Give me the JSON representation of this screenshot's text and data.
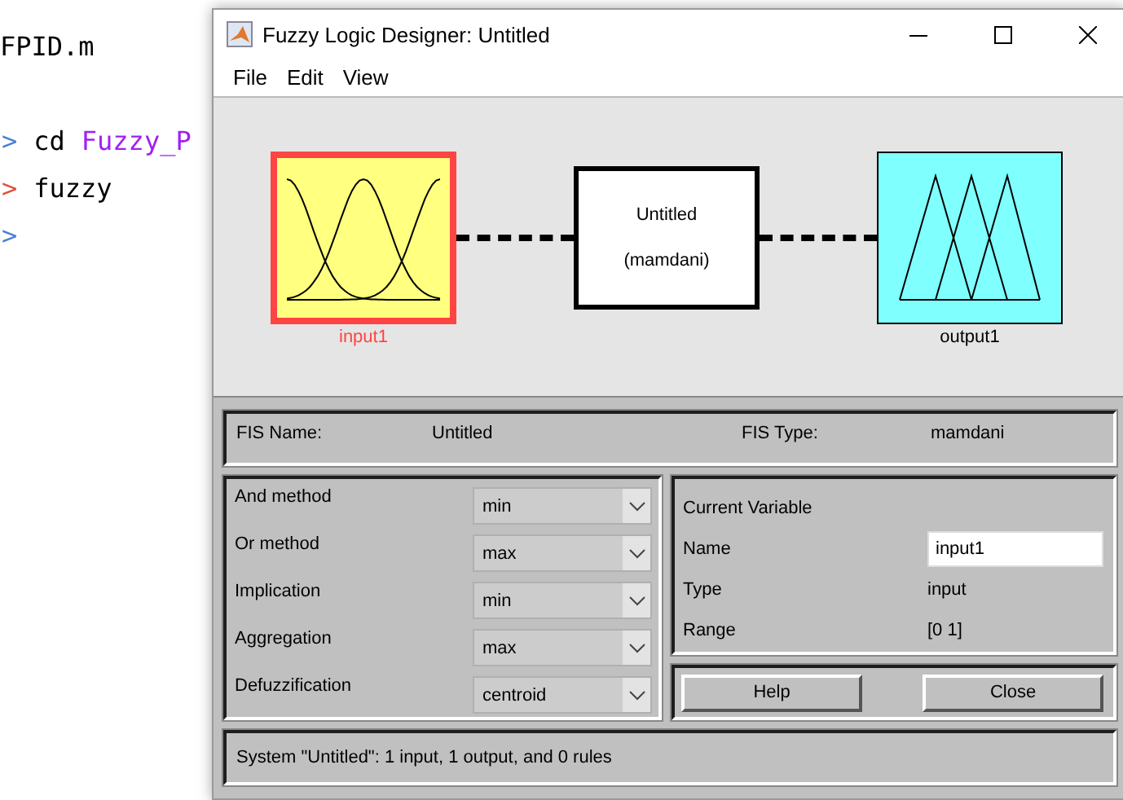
{
  "editor": {
    "file_line": "FPID.m",
    "lines": [
      {
        "prompt": ">",
        "color": "#4a7fd6",
        "parts": [
          {
            "text": "cd",
            "kind": "command"
          },
          {
            "text": "Fuzzy_P",
            "kind": "argument"
          }
        ]
      },
      {
        "prompt": ">",
        "color": "#e0513a",
        "parts": [
          {
            "text": "fuzzy",
            "kind": "command"
          }
        ]
      },
      {
        "prompt": ">",
        "color": "#4a7fd6"
      }
    ]
  },
  "window": {
    "title": "Fuzzy Logic Designer: Untitled",
    "menu": [
      "File",
      "Edit",
      "View"
    ],
    "diagram": {
      "input": {
        "label": "input1",
        "selected": true
      },
      "system": {
        "name": "Untitled",
        "type": "(mamdani)"
      },
      "output": {
        "label": "output1",
        "selected": false
      }
    },
    "fis": {
      "name_label": "FIS Name:",
      "name": "Untitled",
      "type_label": "FIS Type:",
      "type": "mamdani"
    },
    "methods": [
      {
        "label": "And method",
        "value": "min"
      },
      {
        "label": "Or method",
        "value": "max"
      },
      {
        "label": "Implication",
        "value": "min"
      },
      {
        "label": "Aggregation",
        "value": "max"
      },
      {
        "label": "Defuzzification",
        "value": "centroid"
      }
    ],
    "current_variable": {
      "title": "Current Variable",
      "name_label": "Name",
      "name": "input1",
      "type_label": "Type",
      "type": "input",
      "range_label": "Range",
      "range": "[0 1]"
    },
    "buttons": [
      "Help",
      "Close"
    ],
    "status": "System \"Untitled\": 1 input, 1 output, and 0 rules"
  }
}
